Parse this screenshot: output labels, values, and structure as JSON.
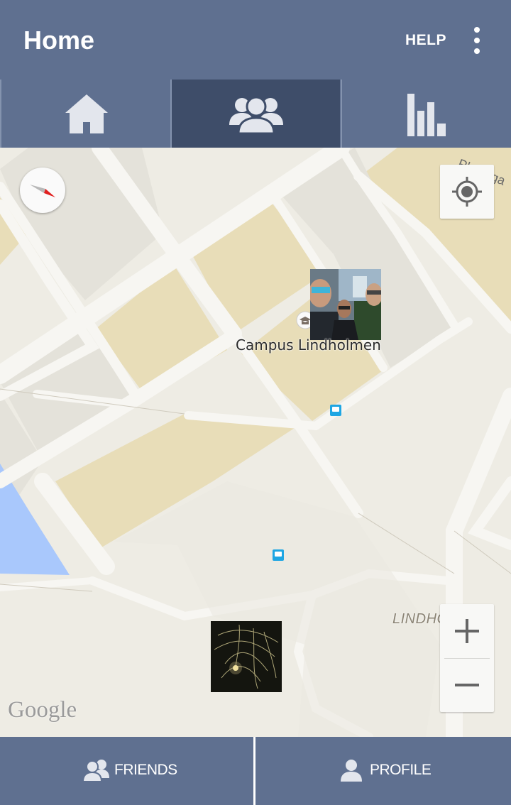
{
  "appbar": {
    "title": "Home",
    "help_label": "HELP"
  },
  "tabs": [
    {
      "name": "home",
      "icon": "home-icon",
      "selected": false
    },
    {
      "name": "friends",
      "icon": "friends-icon",
      "selected": true
    },
    {
      "name": "stats",
      "icon": "bar-chart-icon",
      "selected": false
    }
  ],
  "map": {
    "place_label": "Campus Lindholmen",
    "area_label": "LINDHOLMEN",
    "road_label": "Plejadga",
    "attribution": "Google",
    "zoom_in_label": "+",
    "zoom_out_label": "−"
  },
  "bottom": {
    "friends_label": "FRIENDS",
    "profile_label": "PROFILE"
  },
  "colors": {
    "primary": "#5f7090",
    "selected_tab": "#3e4d69",
    "map_bg": "#eeece4",
    "block": "#e8ddb8",
    "water": "#a9c8fc",
    "transit": "#1ea6e3"
  }
}
